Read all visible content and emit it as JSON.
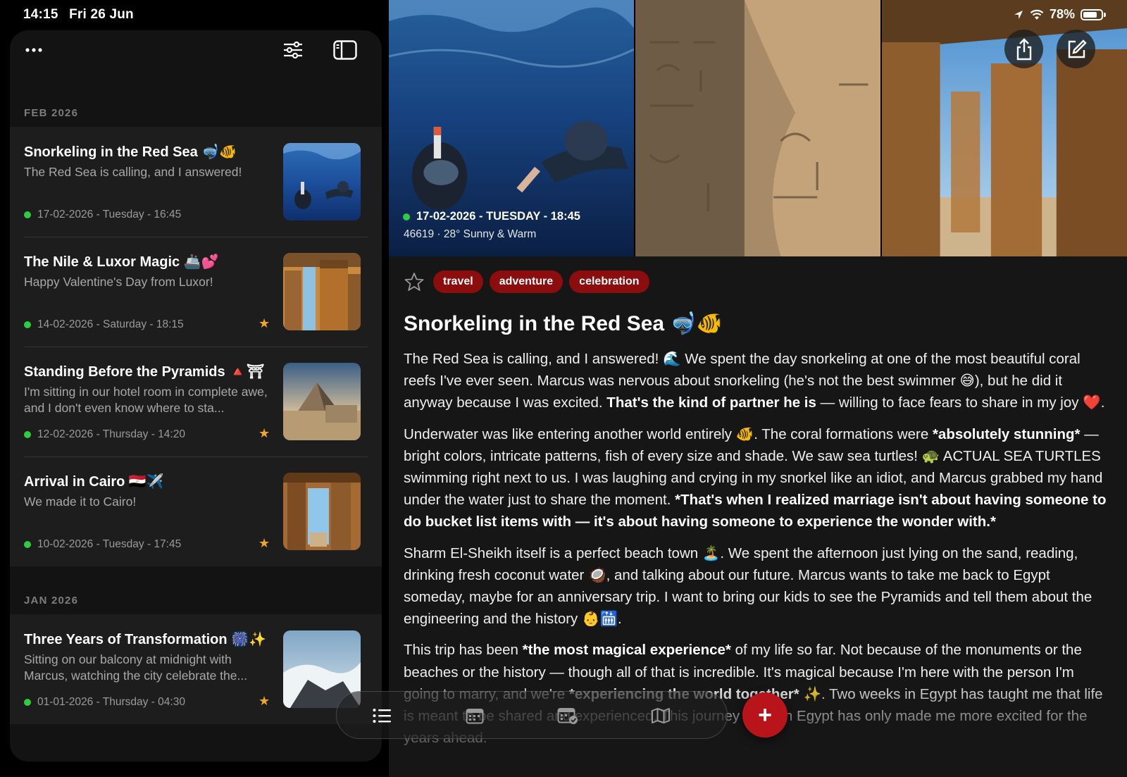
{
  "status": {
    "time": "14:15",
    "date": "Fri 26 Jun",
    "battery": "78%"
  },
  "sidebar": {
    "sections": [
      {
        "label": "FEB 2026"
      },
      {
        "label": "JAN 2026"
      }
    ],
    "entries": [
      {
        "title": "Snorkeling in the Red Sea 🤿🐠",
        "excerpt": "The Red Sea is calling, and I answered!",
        "meta": "17-02-2026 - Tuesday - 16:45",
        "starred": false,
        "thumb": "underwater-snorkelers"
      },
      {
        "title": "The Nile & Luxor Magic 🚢💕",
        "excerpt": "Happy Valentine's Day from Luxor!",
        "meta": "14-02-2026 - Saturday - 18:15",
        "starred": true,
        "thumb": "temple-columns"
      },
      {
        "title": "Standing Before the Pyramids 🔺⛩",
        "excerpt": "I'm sitting in our hotel room in complete awe, and I don't even know where to sta...",
        "meta": "12-02-2026 - Thursday - 14:20",
        "starred": true,
        "thumb": "pyramid"
      },
      {
        "title": "Arrival in Cairo 🇪🇬✈️",
        "excerpt": "We made it to Cairo!",
        "meta": "10-02-2026 - Tuesday - 17:45",
        "starred": true,
        "thumb": "temple-hall"
      },
      {
        "title": "Three Years of Transformation 🎆✨",
        "excerpt": "Sitting on our balcony at midnight with Marcus, watching the city celebrate the...",
        "meta": "01-01-2026 - Thursday - 04:30",
        "starred": true,
        "thumb": "waves-rocks"
      }
    ]
  },
  "detail": {
    "date": "17-02-2026 - TUESDAY - 18:45",
    "weather": "46619 · 28°  Sunny & Warm",
    "tags": [
      "travel",
      "adventure",
      "celebration"
    ],
    "title": "Snorkeling in the Red Sea 🤿🐠",
    "p1a": "The Red Sea is calling, and I answered! 🌊 We spent the day snorkeling at one of the most beautiful coral reefs I've ever seen. Marcus was nervous about snorkeling (he's not the best swimmer 😅), but he did it anyway because I was excited. ",
    "p1b": "That's the kind of partner he is",
    "p1c": " — willing to face fears to share in my joy ❤️.",
    "p2a": "Underwater was like entering another world entirely 🐠. The coral formations were ",
    "p2b": "*absolutely stunning*",
    "p2c": " — bright colors, intricate patterns, fish of every size and shade. We saw sea turtles! 🐢 ACTUAL SEA TURTLES swimming right next to us. I was laughing and crying in my snorkel like an idiot, and Marcus grabbed my hand under the water just to share the moment. ",
    "p2d": "*That's when I realized marriage isn't about having someone to do bucket list items with — it's about having someone to experience the wonder with.*",
    "p3": "Sharm El-Sheikh itself is a perfect beach town 🏝️. We spent the afternoon just lying on the sand, reading, drinking fresh coconut water 🥥, and talking about our future. Marcus wants to take me back to Egypt someday, maybe for an anniversary trip. I want to bring our kids to see the Pyramids and tell them about the engineering and the history 👶🛗.",
    "p4a": "This trip has been ",
    "p4b": "*the most magical experience*",
    "p4c": " of my life so far. Not because of the monuments or the beaches or the history — though all of that is incredible. It's magical because I'm here with the person I'm going to marry, and we're ",
    "p4d": "*experiencing the world together*",
    "p4e": " ✨. Two weeks in Egypt has taught me that life is meant to be shared and experienced. This journey through Egypt has only made me more excited for the years ahead."
  },
  "toolbar": {
    "add_label": "+"
  },
  "icons": {
    "more": "ellipsis-icon",
    "filter": "sliders-icon",
    "sidebar_toggle": "sidebar-icon",
    "share": "share-icon",
    "edit": "compose-icon",
    "list": "list-icon",
    "calendar": "calendar-icon",
    "calendar_check": "calendar-badge-icon",
    "map": "map-icon"
  },
  "colors": {
    "tag": "#8b0d0d",
    "fab": "#b8141a",
    "star": "#f4a623",
    "dot": "#2ecc40"
  }
}
